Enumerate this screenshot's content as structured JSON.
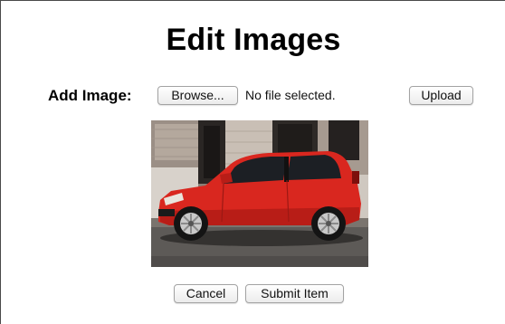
{
  "page": {
    "title": "Edit Images"
  },
  "add_image": {
    "label": "Add Image:",
    "browse_label": "Browse...",
    "file_status": "No file selected.",
    "upload_label": "Upload"
  },
  "preview": {
    "subject": "red hatchback car parked on street",
    "car_color": "#d9271f"
  },
  "actions": {
    "cancel_label": "Cancel",
    "submit_label": "Submit Item"
  },
  "colors": {
    "background": "#ffffff",
    "text": "#000000",
    "button_border": "#a3a3a3"
  }
}
